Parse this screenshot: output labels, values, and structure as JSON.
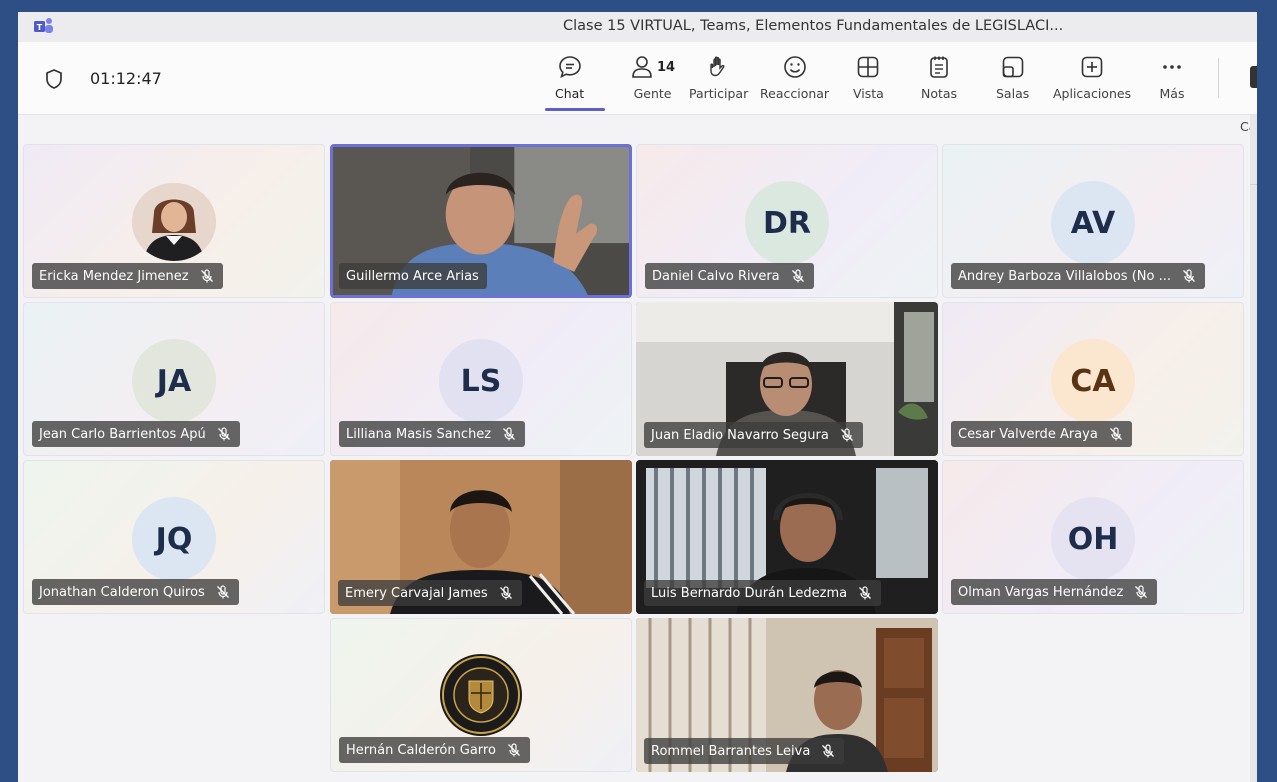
{
  "window": {
    "title": "Clase 15 VIRTUAL, Teams, Elementos Fundamentales de LEGISLACI...",
    "timer": "01:12:47"
  },
  "toolbar": {
    "chat": "Chat",
    "people": "Gente",
    "people_count": "14",
    "participate": "Participar",
    "react": "Reaccionar",
    "view": "Vista",
    "notes": "Notas",
    "rooms": "Salas",
    "apps": "Aplicaciones",
    "more": "Más",
    "camera_cut": "Cá"
  },
  "participants": [
    {
      "name": "Ericka Mendez Jimenez",
      "initials": "",
      "muted": true
    },
    {
      "name": "Guillermo Arce Arias",
      "initials": "",
      "muted": false
    },
    {
      "name": "Daniel Calvo Rivera",
      "initials": "DR",
      "muted": true
    },
    {
      "name": "Andrey Barboza Villalobos (No ...",
      "initials": "AV",
      "muted": true
    },
    {
      "name": "Jean Carlo Barrientos Apú",
      "initials": "JA",
      "muted": true
    },
    {
      "name": "Lilliana Masis Sanchez",
      "initials": "LS",
      "muted": true
    },
    {
      "name": "Juan Eladio Navarro Segura",
      "initials": "",
      "muted": true
    },
    {
      "name": "Cesar Valverde Araya",
      "initials": "CA",
      "muted": true
    },
    {
      "name": "Jonathan Calderon Quiros",
      "initials": "JQ",
      "muted": true
    },
    {
      "name": "Emery Carvajal James",
      "initials": "",
      "muted": true
    },
    {
      "name": "Luis Bernardo Durán Ledezma",
      "initials": "",
      "muted": true
    },
    {
      "name": "Olman Vargas Hernández",
      "initials": "OH",
      "muted": true
    },
    {
      "name": "Hernán Calderón Garro",
      "initials": "",
      "muted": true
    },
    {
      "name": "Rommel Barrantes Leiva",
      "initials": "",
      "muted": true
    }
  ],
  "colors": {
    "accent": "#5b5fc7",
    "avatar_dr": "#dbe8e0",
    "avatar_av": "#dce6f3",
    "avatar_ja": "#e2e6dc",
    "avatar_ls": "#e2e1f1",
    "avatar_ca": "#fbe6cf",
    "avatar_jq": "#dbe6f2",
    "avatar_oh": "#e5e2f1"
  }
}
